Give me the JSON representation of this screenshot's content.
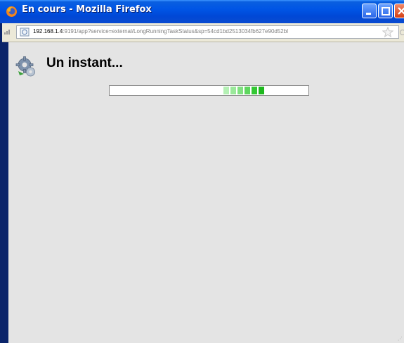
{
  "window": {
    "title": "En cours - Mozilla Firefox"
  },
  "address_bar": {
    "url_host": "192.168.1.4",
    "url_rest": ":9191/app?service=external/LongRunningTaskStatus&sp=54cd1bd2513034fb627e90d52bl"
  },
  "content": {
    "heading": "Un instant...",
    "progress_indicator": {
      "segment_colors": [
        "#b4f0b4",
        "#9ae89a",
        "#80e080",
        "#5ed65e",
        "#34c834",
        "#1eb81e"
      ]
    }
  },
  "colors": {
    "titlebar": "#0055e5",
    "content_bg": "#e4e4e4",
    "progress_green": "#1eb81e"
  },
  "icons": {
    "app": "firefox-icon",
    "site": "site-identity-icon",
    "bookmark": "star-icon",
    "loading": "gears-icon"
  }
}
